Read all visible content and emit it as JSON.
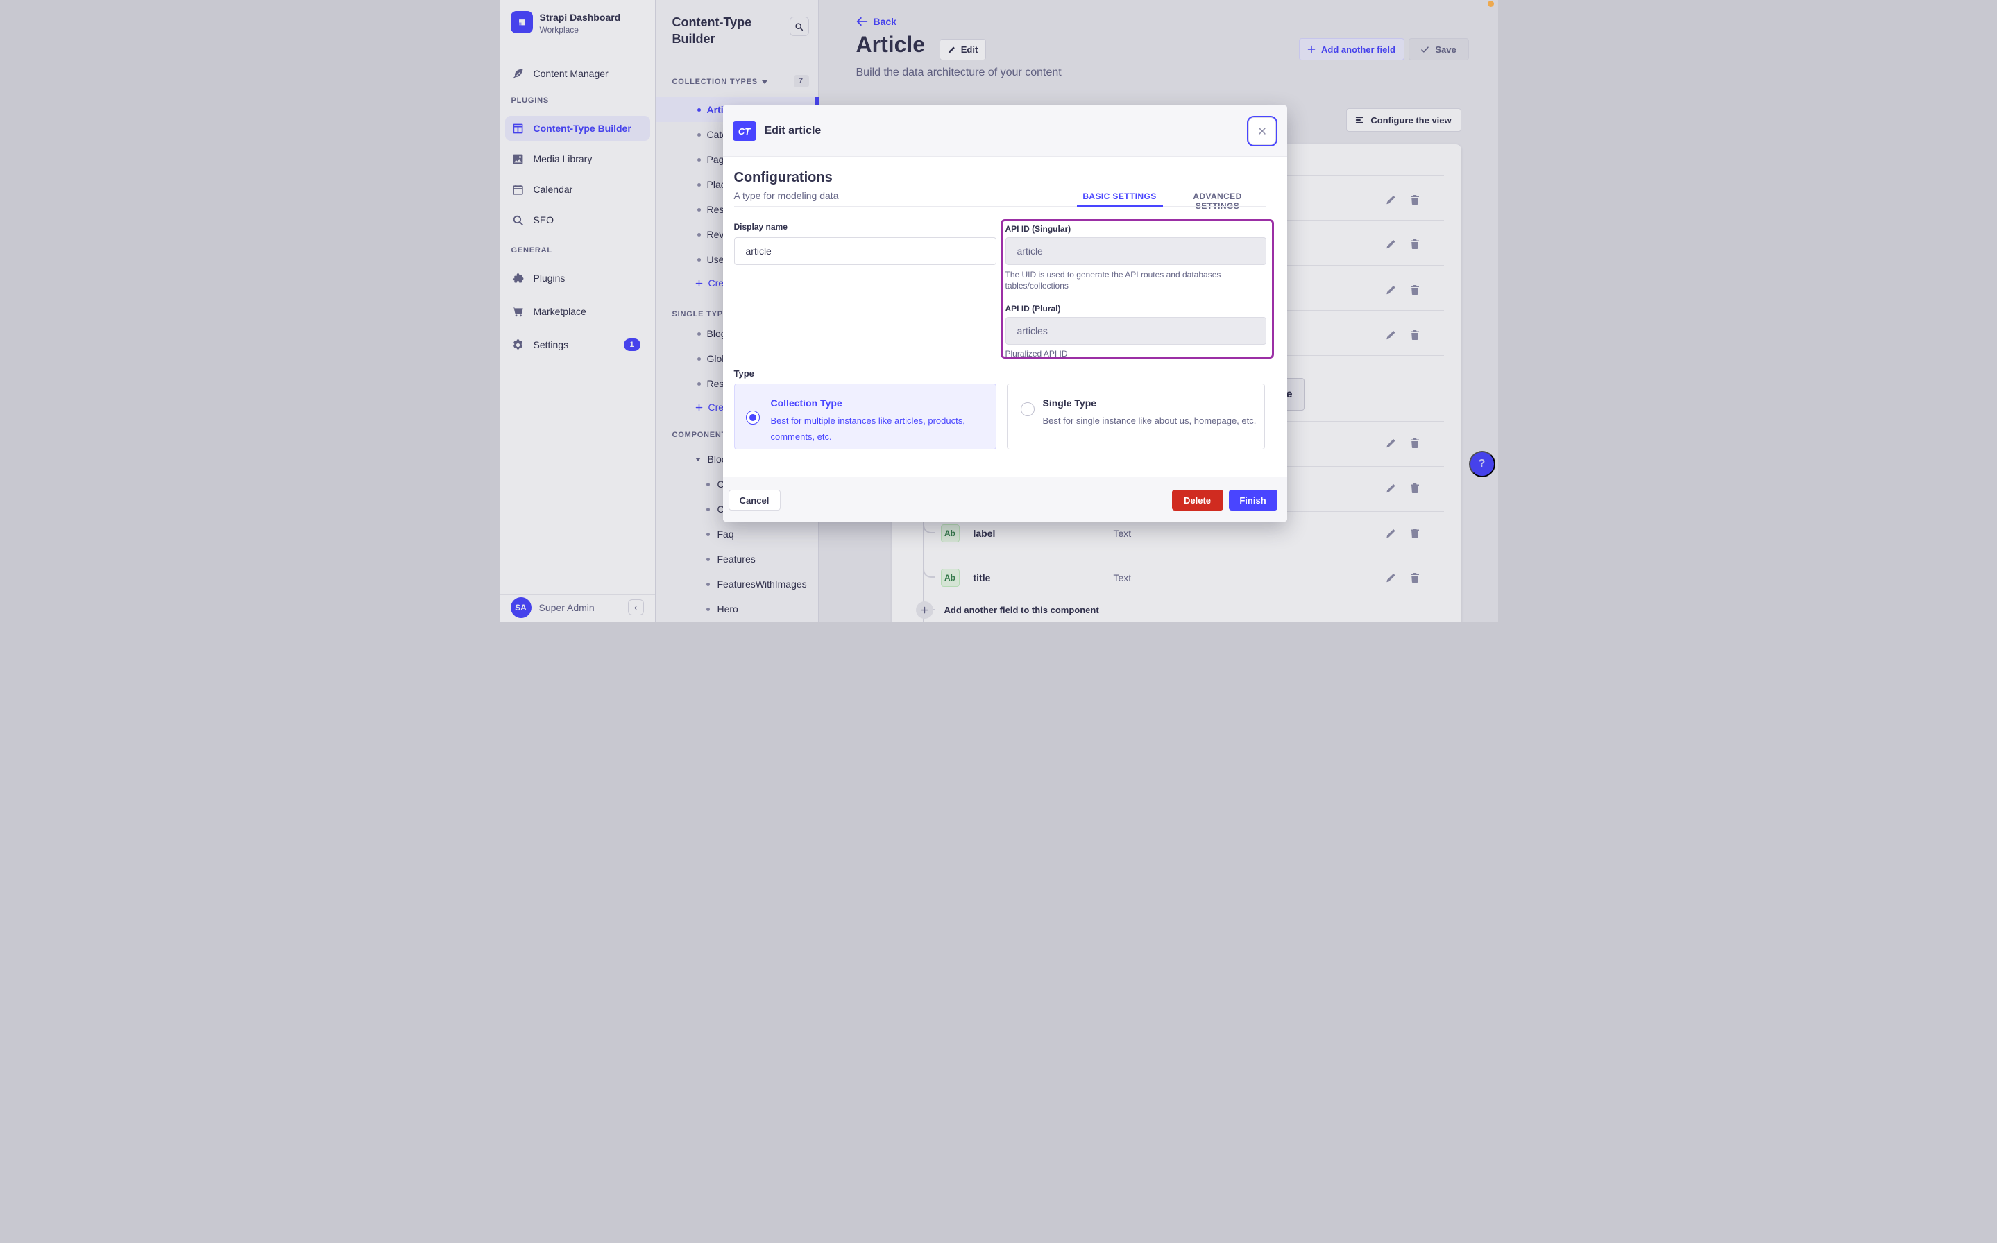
{
  "sidebar": {
    "brand": {
      "title": "Strapi Dashboard",
      "subtitle": "Workplace"
    },
    "content_manager": "Content Manager",
    "sections": [
      {
        "label": "PLUGINS",
        "items": [
          {
            "label": "Content-Type Builder",
            "icon": "layout-icon",
            "active": true
          },
          {
            "label": "Media Library",
            "icon": "image-icon"
          },
          {
            "label": "Calendar",
            "icon": "calendar-icon"
          },
          {
            "label": "SEO",
            "icon": "magnifier-icon"
          }
        ]
      },
      {
        "label": "GENERAL",
        "items": [
          {
            "label": "Plugins",
            "icon": "puzzle-icon"
          },
          {
            "label": "Marketplace",
            "icon": "cart-icon"
          },
          {
            "label": "Settings",
            "icon": "gear-icon",
            "badge": "1"
          }
        ]
      }
    ],
    "user": {
      "initials": "SA",
      "name": "Super Admin"
    }
  },
  "nav_panel": {
    "title": "Content-Type Builder",
    "collection_types": {
      "header": "COLLECTION TYPES",
      "count": "7",
      "items": [
        "Article",
        "Category",
        "Page",
        "Place",
        "Rest",
        "Review",
        "User"
      ],
      "create": "Create"
    },
    "single_types": {
      "header": "SINGLE TYPES",
      "items": [
        "Blog",
        "Global",
        "Rest"
      ],
      "create": "Create"
    },
    "components": {
      "header": "COMPONENTS",
      "group": "Blocks",
      "children": [
        "Cta",
        "CtaCommandLine",
        "Faq",
        "Features",
        "FeaturesWithImages",
        "Hero"
      ]
    }
  },
  "header": {
    "back": "Back",
    "title": "Article",
    "edit": "Edit",
    "subtitle": "Build the data architecture of your content",
    "add_field": "Add another field",
    "save": "Save"
  },
  "content": {
    "configure_view": "Configure the view",
    "fields": [
      {
        "badge": "Ab",
        "name": "label",
        "type": "Text"
      },
      {
        "badge": "Ab",
        "name": "title",
        "type": "Text"
      }
    ],
    "add_component_field": "Add another field to this component",
    "partial_text": "e",
    "help": "?"
  },
  "modal": {
    "badge": "CT",
    "title": "Edit article",
    "heading": "Configurations",
    "subheading": "A type for modeling data",
    "tabs": {
      "basic": "BASIC SETTINGS",
      "advanced": "ADVANCED SETTINGS"
    },
    "display_name": {
      "label": "Display name",
      "value": "article"
    },
    "api_singular": {
      "label": "API ID (Singular)",
      "value": "article",
      "hint": "The UID is used to generate the API routes and databases tables/collections"
    },
    "api_plural": {
      "label": "API ID (Plural)",
      "value": "articles",
      "hint": "Pluralized API ID"
    },
    "type": {
      "label": "Type",
      "collection": {
        "title": "Collection Type",
        "desc": "Best for multiple instances like articles, products, comments, etc.",
        "selected": true
      },
      "single": {
        "title": "Single Type",
        "desc": "Best for single instance like about us, homepage, etc.",
        "selected": false
      }
    },
    "footer": {
      "cancel": "Cancel",
      "delete": "Delete",
      "finish": "Finish"
    }
  },
  "colors": {
    "primary": "#4945FF",
    "primary_light": "#F0F0FF",
    "annotation": "#9B2FA5",
    "danger": "#D02B20",
    "text": "#32324D",
    "text_secondary": "#666687",
    "border": "#DCDCE4",
    "badge_green_bg": "#EAFBE7",
    "badge_green_text": "#328048",
    "recording_dot": "#EDA94F"
  }
}
